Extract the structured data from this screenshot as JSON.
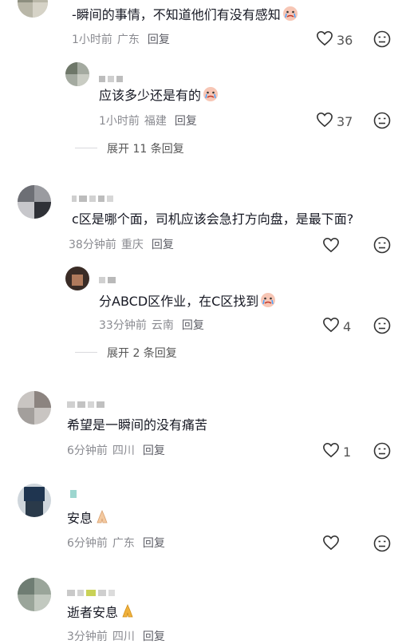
{
  "comments": [
    {
      "text": "-瞬间的事情，不知道他们有没有感知",
      "emoji": "crying-emoji",
      "time": "1小时前",
      "location": "广东",
      "reply": "回复",
      "likes": "36",
      "replies": [
        {
          "text": "应该多少还是有的",
          "emoji": "crying-emoji",
          "time": "1小时前",
          "location": "福建",
          "reply": "回复",
          "likes": "37"
        }
      ],
      "expand": "展开 11 条回复"
    },
    {
      "text": "c区是哪个面，司机应该会急打方向盘，是最下面?",
      "time": "38分钟前",
      "location": "重庆",
      "reply": "回复",
      "likes": "",
      "replies": [
        {
          "text": "分ABCD区作业，在C区找到",
          "emoji": "crying-emoji",
          "time": "33分钟前",
          "location": "云南",
          "reply": "回复",
          "likes": "4"
        }
      ],
      "expand": "展开 2 条回复"
    },
    {
      "text": "希望是一瞬间的没有痛苦",
      "time": "6分钟前",
      "location": "四川",
      "reply": "回复",
      "likes": "1"
    },
    {
      "text": "安息",
      "emoji": "praying-hands-emoji",
      "time": "6分钟前",
      "location": "广东",
      "reply": "回复",
      "likes": ""
    },
    {
      "text": "逝者安息",
      "emoji": "praying-hands-emoji",
      "time": "3分钟前",
      "location": "四川",
      "reply": "回复",
      "likes": ""
    }
  ],
  "colors": {
    "text": "#161823",
    "meta": "#8a8b91",
    "reply": "#5d5e66",
    "divider": "#d9d9de"
  },
  "icons": {
    "like": "heart-outline-icon",
    "dislike": "dislike-face-icon"
  }
}
